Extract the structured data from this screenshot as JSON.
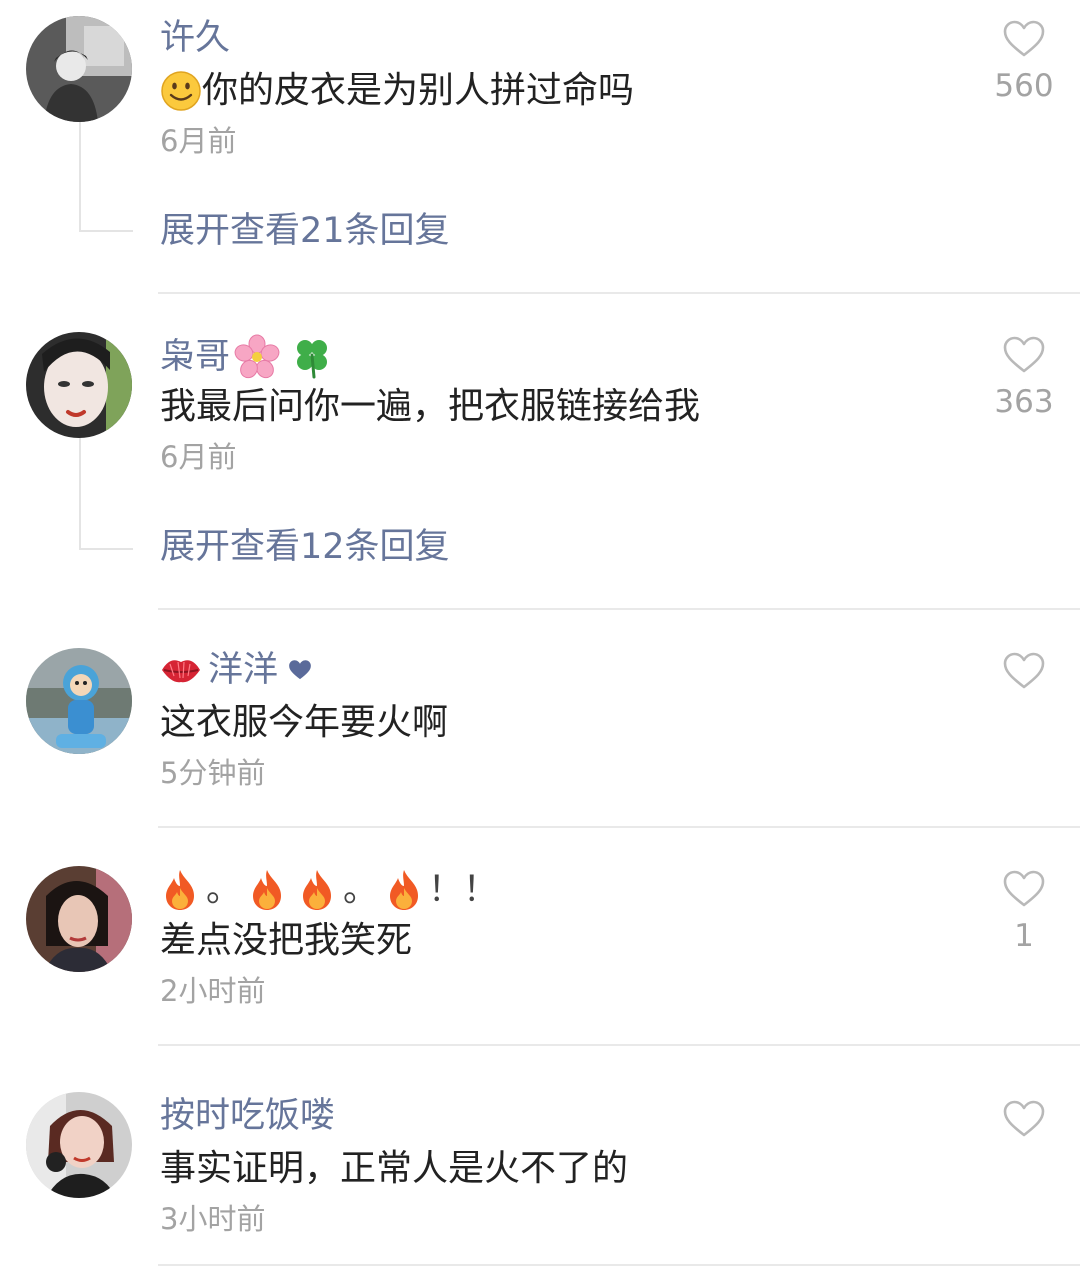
{
  "comments": [
    {
      "username": "许久",
      "text": "你的皮衣是为别人拼过命吗",
      "time": "6月前",
      "likes": "560",
      "replies": "展开查看21条回复",
      "avatar_color": "#6e6e6e"
    },
    {
      "username": "枭哥",
      "text": "我最后问你一遍，把衣服链接给我",
      "time": "6月前",
      "likes": "363",
      "replies": "展开查看12条回复",
      "avatar_color": "#d9c9c4"
    },
    {
      "username": "洋洋",
      "text": "这衣服今年要火啊",
      "time": "5分钟前",
      "likes": "",
      "avatar_color": "#8fb3c9"
    },
    {
      "username_parts": [
        "。",
        "。",
        "！！"
      ],
      "text": "差点没把我笑死",
      "time": "2小时前",
      "likes": "1",
      "avatar_color": "#7a5a4c"
    },
    {
      "username": "按时吃饭喽",
      "text": "事实证明，正常人是火不了的",
      "time": "3小时前",
      "likes": "",
      "avatar_color": "#c9a9a0"
    }
  ],
  "colors": {
    "name": "#66759a",
    "text": "#222222",
    "meta": "#a3a3a3",
    "divider": "#e9e9e9"
  },
  "icons": [
    "heart-outline-icon",
    "smile-emoji-icon",
    "cherry-blossom-emoji-icon",
    "four-leaf-clover-emoji-icon",
    "kiss-lips-emoji-icon",
    "heart-emoji-icon",
    "fire-emoji-icon"
  ]
}
